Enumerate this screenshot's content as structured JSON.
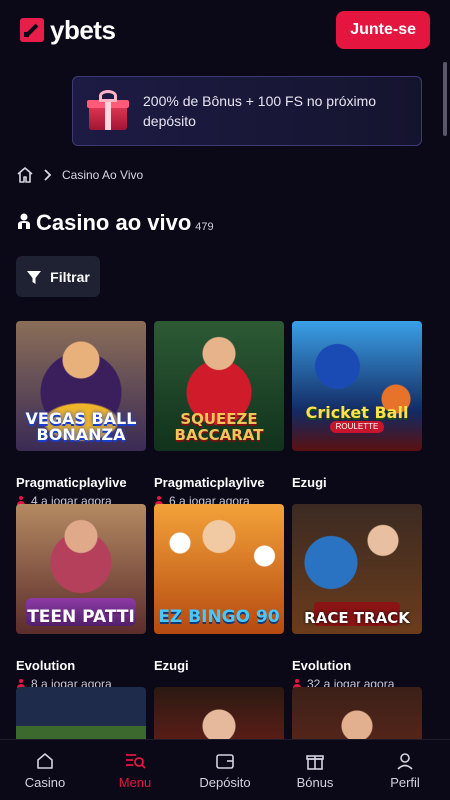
{
  "header": {
    "logo_text": "ybets",
    "join_label": "Junte-se",
    "brand_color": "#e4163f"
  },
  "promo": {
    "text": "200% de Bônus + 100 FS no próximo depósito",
    "icon": "gift-icon"
  },
  "breadcrumb": {
    "home_icon": "home-icon",
    "current": "Casino Ao Vivo"
  },
  "title": {
    "text": "Casino ao vivo",
    "count": "479"
  },
  "filter": {
    "label": "Filtrar"
  },
  "games": [
    {
      "art": "VEGAS BALL BONANZA",
      "provider": "Pragmaticplaylive",
      "players": "4 a jogar agora"
    },
    {
      "art": "SQUEEZE BACCARAT",
      "provider": "Pragmaticplaylive",
      "players": "6 a jogar agora"
    },
    {
      "art": "Cricket Ball",
      "art_sub": "ROULETTE",
      "provider": "Ezugi",
      "players": ""
    },
    {
      "art": "TEEN PATTI",
      "provider": "Evolution",
      "players": "8 a jogar agora"
    },
    {
      "art": "EZ BINGO 90",
      "provider": "Ezugi",
      "players": ""
    },
    {
      "art": "RACE TRACK",
      "provider": "Evolution",
      "players": "32 a jogar agora"
    },
    {
      "art": "",
      "provider": "",
      "players": ""
    },
    {
      "art": "",
      "provider": "",
      "players": ""
    },
    {
      "art": "",
      "provider": "",
      "players": ""
    }
  ],
  "nav": [
    {
      "label": "Casino",
      "icon": "home-icon",
      "active": false
    },
    {
      "label": "Menu",
      "icon": "menu-search-icon",
      "active": true
    },
    {
      "label": "Depósito",
      "icon": "wallet-icon",
      "active": false
    },
    {
      "label": "Bónus",
      "icon": "gift-icon",
      "active": false
    },
    {
      "label": "Perfil",
      "icon": "user-icon",
      "active": false
    }
  ]
}
